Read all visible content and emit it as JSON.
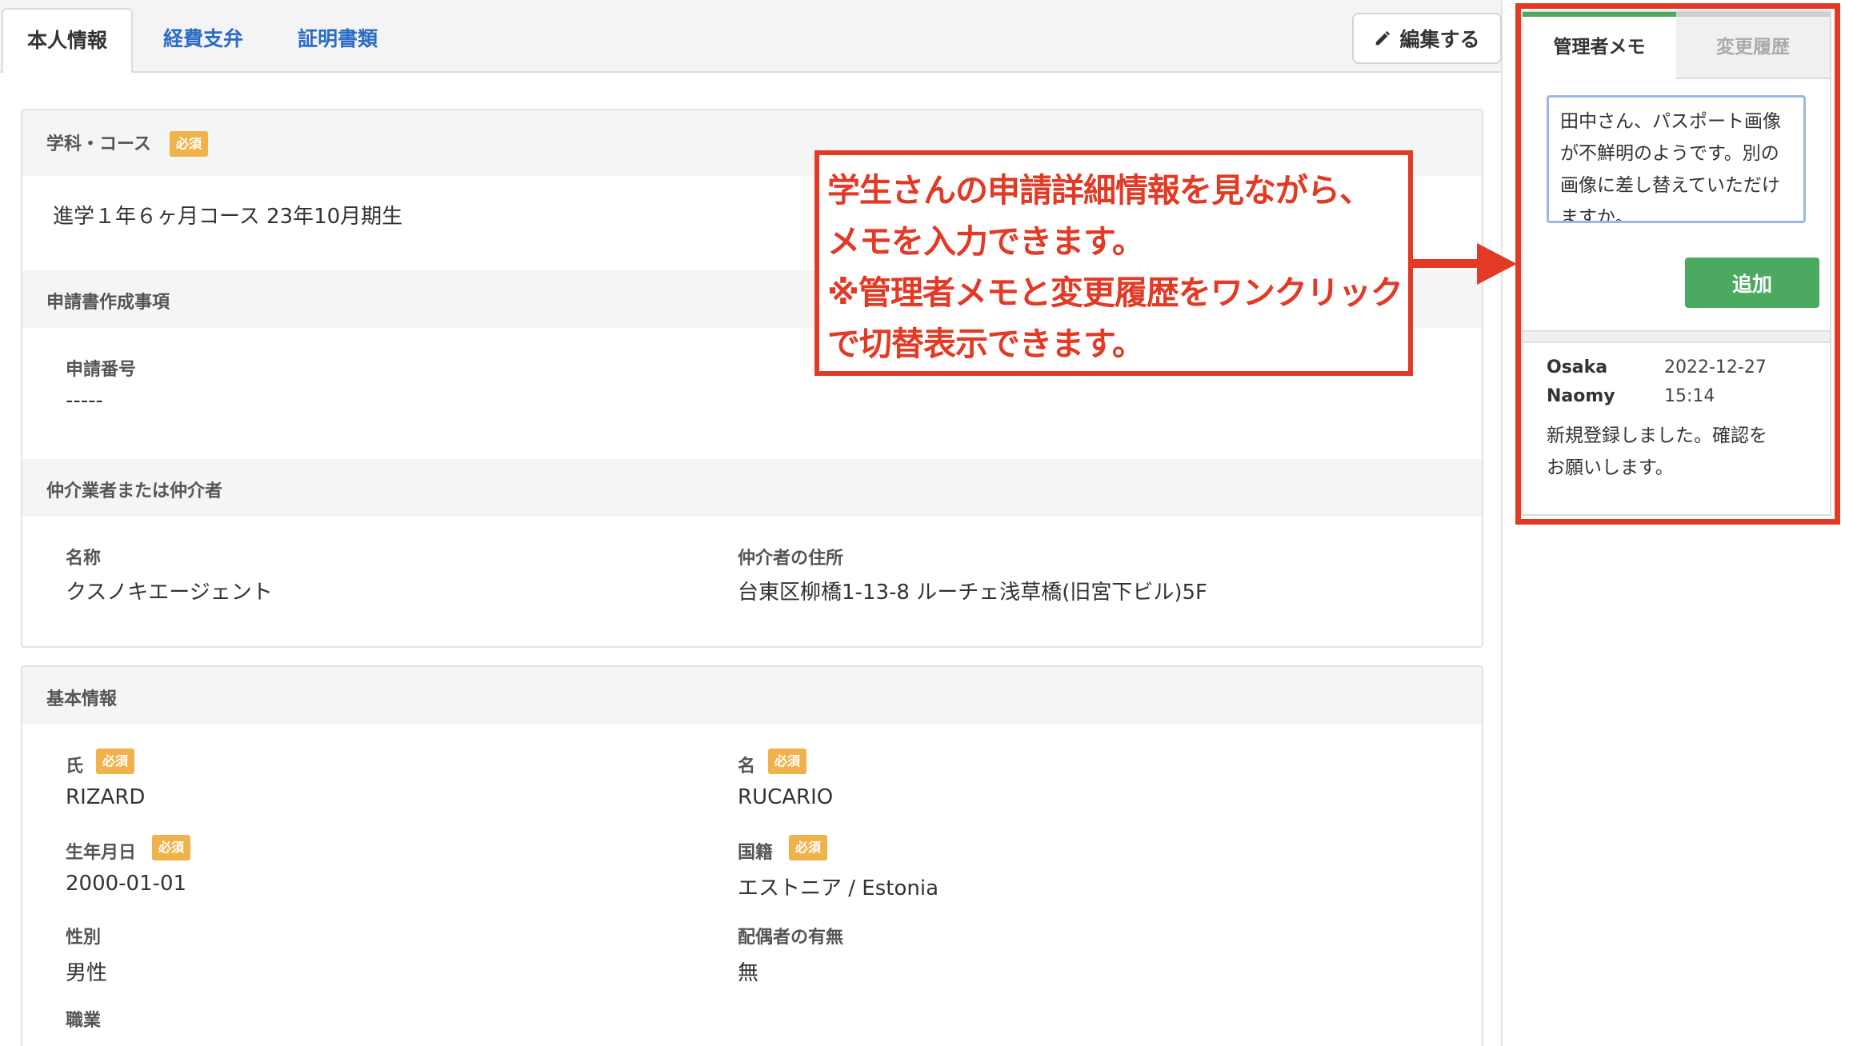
{
  "tabs": [
    {
      "label": "本人情報",
      "active": true
    },
    {
      "label": "経費支弁",
      "active": false
    },
    {
      "label": "証明書類",
      "active": false
    }
  ],
  "toolbar": {
    "edit_label": "編集する",
    "edit_icon": "pencil-icon"
  },
  "badge_required": "必須",
  "course_section": {
    "title": "学科・コース",
    "value": "進学１年６ヶ月コース 23年10月期生"
  },
  "application_section": {
    "title": "申請書作成事項",
    "number_label": "申請番号",
    "number_value": "-----"
  },
  "agent_section": {
    "title": "仲介業者または仲介者",
    "name_label": "名称",
    "name_value": "クスノキエージェント",
    "address_label": "仲介者の住所",
    "address_value": "台東区柳橋1-13-8 ルーチェ浅草橋(旧宮下ビル)5F"
  },
  "basic_section": {
    "title": "基本情報",
    "last_name_label": "氏",
    "last_name_value": "RIZARD",
    "first_name_label": "名",
    "first_name_value": "RUCARIO",
    "birth_label": "生年月日",
    "birth_value": "2000-01-01",
    "nationality_label": "国籍",
    "nationality_value": "エストニア / Estonia",
    "gender_label": "性別",
    "gender_value": "男性",
    "spouse_label": "配偶者の有無",
    "spouse_value": "無",
    "occupation_label": "職業"
  },
  "memo_panel": {
    "tab_admin_memo": "管理者メモ",
    "tab_change_history": "変更履歴",
    "input_value": "田中さん、パスポート画像が不鮮明のようです。別の画像に差し替えていただけますか。",
    "add_label": "追加",
    "entry": {
      "author_first": "Osaka",
      "author_last": "Naomy",
      "date": "2022-12-27",
      "time": "15:14",
      "text_line1": "新規登録しました。確認を",
      "text_line2": "お願いします。"
    }
  },
  "annotation": {
    "line1": "学生さんの申請詳細情報を見ながら、",
    "line2": "メモを入力できます。",
    "line3": "※管理者メモと変更履歴をワンクリック",
    "line4": "で切替表示できます。"
  },
  "colors": {
    "accent_green": "#4caa60",
    "link_blue": "#2b6cc4",
    "badge_orange": "#f0b24a",
    "annotation_red": "#e23a25"
  }
}
